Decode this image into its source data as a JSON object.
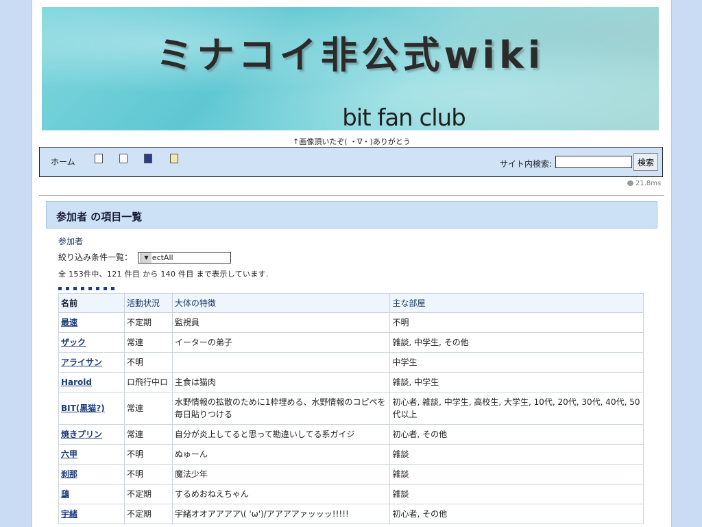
{
  "banner": {
    "title": "ミナコイ非公式wiki",
    "subtitle": "bit fan club"
  },
  "caption": "↑画像頂いたぞ( ・∇・)ありがとう",
  "nav": {
    "home": "ホーム",
    "search_label": "サイト内検索:",
    "search_value": "",
    "search_button": "検索"
  },
  "timing": "21.8ms",
  "page_title": "参加者 の項目一覧",
  "breadcrumb": "参加者",
  "filter": {
    "label": "絞り込み条件一覧：",
    "selected": "SelectAll"
  },
  "count_text": "全 153件中、121 件目 から 140 件目 まで表示しています.",
  "table": {
    "headers": [
      "名前",
      "活動状況",
      "大体の特徴",
      "主な部屋"
    ],
    "rows": [
      {
        "name": "最速",
        "status": "不定期",
        "trait": "監視員",
        "rooms": "不明"
      },
      {
        "name": "ザック",
        "status": "常連",
        "trait": "イーターの弟子",
        "rooms": "雑談, 中学生, その他"
      },
      {
        "name": "アライサン",
        "status": "不明",
        "trait": "",
        "rooms": "中学生"
      },
      {
        "name": "Harold",
        "status": "ロ飛行中ロ",
        "trait": "主食は猫肉",
        "rooms": "雑談, 中学生"
      },
      {
        "name": "BIT(黒猫?)",
        "status": "常連",
        "trait": "水野情報の拡散のために1枠埋める、水野情報のコピペを毎日貼りつける",
        "rooms": "初心者, 雑談, 中学生, 高校生, 大学生, 10代, 20代, 30代, 40代, 50代以上"
      },
      {
        "name": "焼きプリン",
        "status": "常連",
        "trait": "自分が炎上してると思って勘違いしてる系ガイジ",
        "rooms": "初心者, その他"
      },
      {
        "name": "六甲",
        "status": "不明",
        "trait": "ぬゅーん",
        "rooms": "雑談"
      },
      {
        "name": "刹那",
        "status": "不明",
        "trait": "魔法少年",
        "rooms": "雑談"
      },
      {
        "name": "鴟",
        "status": "不定期",
        "trait": "するめおねえちゃん",
        "rooms": "雑談"
      },
      {
        "name": "宇緒",
        "status": "不定期",
        "trait": "宇緒オオアアアア\\( 'ω')/アアアアァッッッ!!!!!",
        "rooms": "初心者, その他"
      }
    ]
  }
}
